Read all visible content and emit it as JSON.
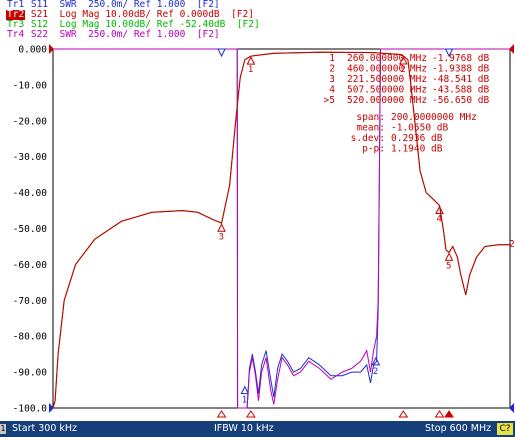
{
  "traces": [
    {
      "tag": "Tr1",
      "text": " S11  SWR  250.0m/ Ref 1.000  [F2]",
      "color": "#1f2bd0"
    },
    {
      "tag": "Tr2",
      "text": " S21  Log Mag 10.00dB/ Ref 0.000dB  [F2]",
      "color": "#c80000"
    },
    {
      "tag": "Tr3",
      "text": " S12  Log Mag 10.00dB/ Ref -52.40dB  [F2]",
      "color": "#00b800"
    },
    {
      "tag": "Tr4",
      "text": " S22  SWR  250.0m/ Ref 1.000  [F2]",
      "color": "#b800b8"
    }
  ],
  "y_axis_labels": [
    "0.000",
    "-10.00",
    "-20.00",
    "-30.00",
    "-40.00",
    "-50.00",
    "-60.00",
    "-70.00",
    "-80.00",
    "-90.00",
    "-100.0"
  ],
  "marker_table": [
    {
      "num": "1",
      "freq": "260.000000 MHz",
      "value": "-1.9768 dB"
    },
    {
      "num": "2",
      "freq": "460.000000 MHz",
      "value": "-1.9388 dB"
    },
    {
      "num": "3",
      "freq": "221.500000 MHz",
      "value": "-48.541 dB"
    },
    {
      "num": "4",
      "freq": "507.500000 MHz",
      "value": "-43.588 dB"
    },
    {
      "num": ">5",
      "freq": "520.000000 MHz",
      "value": "-56.650 dB"
    }
  ],
  "stats": [
    {
      "label": "span:",
      "value": "200.0000000 MHz"
    },
    {
      "label": "mean:",
      "value": "-1.0550 dB"
    },
    {
      "label": "s.dev:",
      "value": "0.2936 dB"
    },
    {
      "label": "p-p:",
      "value": "1.1940 dB"
    }
  ],
  "trace_end_label": "2",
  "status": {
    "channel": "1",
    "start": "Start 300 kHz",
    "ifbw": "IFBW 10 kHz",
    "stop": "Stop 600 MHz",
    "badge": "C?"
  },
  "chart_data": {
    "type": "line",
    "x_unit": "MHz",
    "xlim": [
      0.3,
      600
    ],
    "ylim": [
      -100,
      0
    ],
    "y_divisions": 10,
    "grid": false,
    "series": [
      {
        "name": "S21",
        "color": "#c80000",
        "points": [
          [
            0.3,
            -100
          ],
          [
            3,
            -98
          ],
          [
            7,
            -85
          ],
          [
            15,
            -70
          ],
          [
            30,
            -60
          ],
          [
            55,
            -53
          ],
          [
            90,
            -48
          ],
          [
            130,
            -45.5
          ],
          [
            170,
            -45
          ],
          [
            190,
            -45.5
          ],
          [
            210,
            -47.5
          ],
          [
            221.5,
            -48.5
          ],
          [
            232,
            -38
          ],
          [
            240,
            -20
          ],
          [
            246,
            -8
          ],
          [
            252,
            -3
          ],
          [
            260,
            -1.98
          ],
          [
            290,
            -1.2
          ],
          [
            350,
            -0.9
          ],
          [
            420,
            -1.0
          ],
          [
            455,
            -1.5
          ],
          [
            460,
            -1.94
          ],
          [
            466,
            -3
          ],
          [
            470,
            -10
          ],
          [
            476,
            -22
          ],
          [
            482,
            -34
          ],
          [
            490,
            -40
          ],
          [
            500,
            -42
          ],
          [
            507.5,
            -43.6
          ],
          [
            513,
            -51
          ],
          [
            516,
            -56
          ],
          [
            520,
            -56.65
          ],
          [
            525,
            -55
          ],
          [
            531,
            -58
          ],
          [
            535,
            -62.5
          ],
          [
            539,
            -66
          ],
          [
            542,
            -68.5
          ],
          [
            547,
            -63
          ],
          [
            556,
            -58
          ],
          [
            567,
            -55
          ],
          [
            585,
            -54.5
          ],
          [
            600,
            -54.5
          ]
        ]
      },
      {
        "name": "S12",
        "color": "#00b800",
        "points": [
          [
            0.3,
            -100
          ],
          [
            3,
            -98
          ],
          [
            7,
            -85
          ],
          [
            15,
            -70
          ],
          [
            30,
            -60
          ],
          [
            55,
            -53
          ],
          [
            90,
            -48
          ],
          [
            130,
            -45.5
          ],
          [
            170,
            -45
          ],
          [
            190,
            -45.5
          ],
          [
            210,
            -47.5
          ],
          [
            221.5,
            -48.5
          ],
          [
            232,
            -38
          ],
          [
            240,
            -20
          ],
          [
            246,
            -8
          ],
          [
            252,
            -3
          ],
          [
            260,
            -1.98
          ],
          [
            290,
            -1.2
          ],
          [
            350,
            -0.9
          ],
          [
            420,
            -1.0
          ],
          [
            455,
            -1.5
          ],
          [
            460,
            -1.94
          ],
          [
            466,
            -3
          ],
          [
            470,
            -10
          ],
          [
            476,
            -22
          ],
          [
            482,
            -34
          ],
          [
            490,
            -40
          ],
          [
            500,
            -42
          ],
          [
            507.5,
            -43.6
          ],
          [
            513,
            -51
          ],
          [
            516,
            -56
          ],
          [
            520,
            -56.65
          ],
          [
            525,
            -55
          ],
          [
            531,
            -58
          ],
          [
            535,
            -62.5
          ],
          [
            539,
            -66
          ],
          [
            542,
            -68.5
          ],
          [
            547,
            -63
          ],
          [
            556,
            -58
          ],
          [
            567,
            -55
          ],
          [
            585,
            -54.5
          ],
          [
            600,
            -54.5
          ]
        ]
      },
      {
        "name": "S11",
        "color": "#1f2bd0",
        "points": [
          [
            0.3,
            0
          ],
          [
            242,
            0
          ],
          [
            242.5,
            -100
          ],
          [
            255,
            -100
          ],
          [
            258,
            -89
          ],
          [
            262,
            -85
          ],
          [
            266,
            -90
          ],
          [
            270,
            -96
          ],
          [
            274,
            -88
          ],
          [
            280,
            -84
          ],
          [
            286,
            -92
          ],
          [
            290,
            -97
          ],
          [
            295,
            -89
          ],
          [
            301,
            -85
          ],
          [
            308,
            -87
          ],
          [
            316,
            -90
          ],
          [
            325,
            -89
          ],
          [
            336,
            -86
          ],
          [
            350,
            -88
          ],
          [
            365,
            -91
          ],
          [
            380,
            -91
          ],
          [
            392,
            -90
          ],
          [
            404,
            -90
          ],
          [
            412,
            -88
          ],
          [
            417,
            -93
          ],
          [
            421,
            -88
          ],
          [
            425,
            -87
          ],
          [
            427,
            -72
          ],
          [
            430,
            0
          ],
          [
            600,
            0
          ]
        ]
      },
      {
        "name": "S22",
        "color": "#b800b8",
        "points": [
          [
            0.3,
            0
          ],
          [
            242,
            0
          ],
          [
            242.5,
            -100
          ],
          [
            255,
            -100
          ],
          [
            258,
            -90
          ],
          [
            262,
            -86
          ],
          [
            266,
            -91
          ],
          [
            270,
            -98
          ],
          [
            274,
            -90
          ],
          [
            280,
            -86
          ],
          [
            286,
            -95
          ],
          [
            290,
            -99
          ],
          [
            295,
            -92
          ],
          [
            301,
            -86
          ],
          [
            308,
            -88
          ],
          [
            316,
            -91
          ],
          [
            325,
            -90
          ],
          [
            336,
            -87
          ],
          [
            350,
            -89
          ],
          [
            365,
            -92
          ],
          [
            380,
            -90
          ],
          [
            392,
            -89
          ],
          [
            404,
            -87
          ],
          [
            412,
            -84
          ],
          [
            417,
            -90
          ],
          [
            421,
            -84
          ],
          [
            425,
            -80
          ],
          [
            427,
            -70
          ],
          [
            430,
            0
          ],
          [
            600,
            0
          ]
        ]
      }
    ],
    "markers": [
      {
        "id": "1",
        "x": 260,
        "y": -1.98
      },
      {
        "id": "2",
        "x": 460,
        "y": -1.94
      },
      {
        "id": "3",
        "x": 221.5,
        "y": -48.54
      },
      {
        "id": "4",
        "x": 507.5,
        "y": -43.59
      },
      {
        "id": "5",
        "x": 520,
        "y": -56.65
      }
    ]
  }
}
